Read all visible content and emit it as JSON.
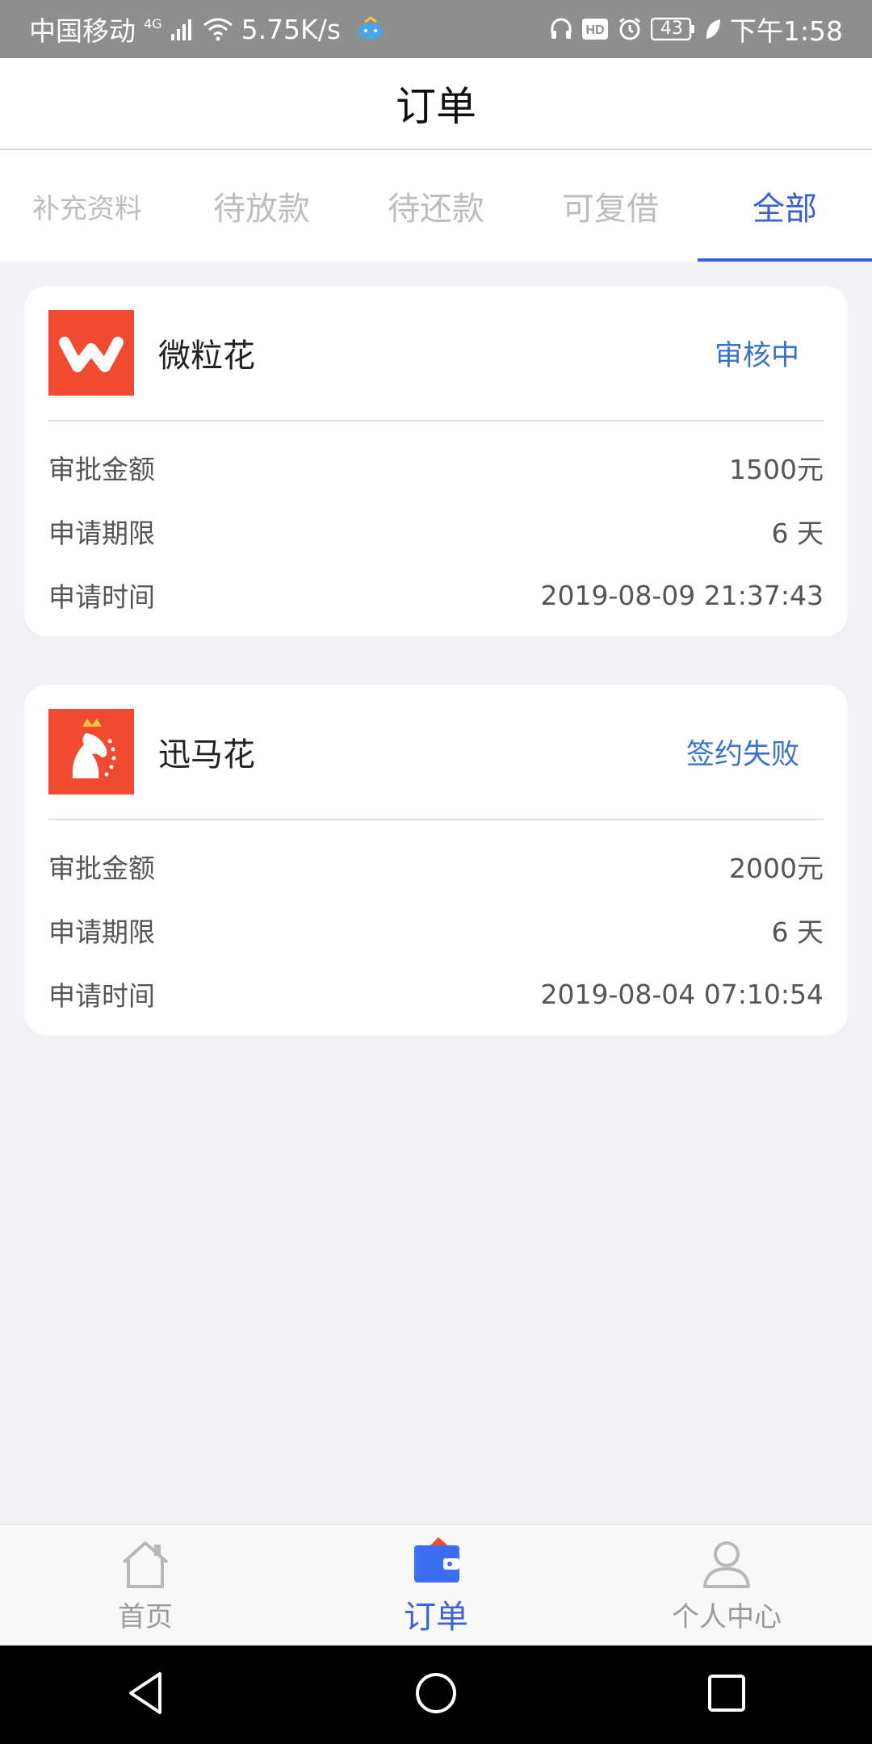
{
  "status_bar": {
    "carrier": "中国移动",
    "network": "4G",
    "speed": "5.75K/s",
    "battery": "43",
    "time": "下午1:58"
  },
  "header": {
    "title": "订单"
  },
  "tabs": [
    {
      "label": "补充资料",
      "active": false
    },
    {
      "label": "待放款",
      "active": false
    },
    {
      "label": "待还款",
      "active": false
    },
    {
      "label": "可复借",
      "active": false
    },
    {
      "label": "全部",
      "active": true
    }
  ],
  "orders": [
    {
      "name": "微粒花",
      "status": "审核中",
      "logo_icon": "w-logo-icon",
      "rows": [
        {
          "label": "审批金额",
          "value": "1500元"
        },
        {
          "label": "申请期限",
          "value": "6 天"
        },
        {
          "label": "申请时间",
          "value": "2019-08-09 21:37:43"
        }
      ]
    },
    {
      "name": "迅马花",
      "status": "签约失败",
      "logo_icon": "horse-logo-icon",
      "rows": [
        {
          "label": "审批金额",
          "value": "2000元"
        },
        {
          "label": "申请期限",
          "value": "6 天"
        },
        {
          "label": "申请时间",
          "value": "2019-08-04 07:10:54"
        }
      ]
    }
  ],
  "bottom_nav": [
    {
      "label": "首页",
      "icon": "home-icon",
      "active": false
    },
    {
      "label": "订单",
      "icon": "wallet-icon",
      "active": true
    },
    {
      "label": "个人中心",
      "icon": "user-icon",
      "active": false
    }
  ],
  "colors": {
    "accent": "#3b5fd0",
    "status_text": "#3a72c9",
    "logo_red": "#f04a30",
    "page_bg": "#f1f1f6"
  }
}
